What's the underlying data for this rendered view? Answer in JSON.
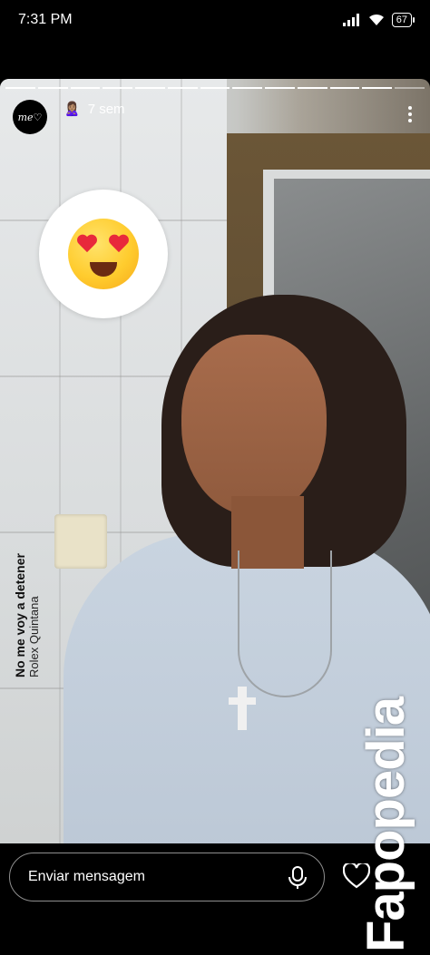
{
  "status_bar": {
    "time": "7:31 PM",
    "battery": "67"
  },
  "story": {
    "progress_segments": 13,
    "progress_done": 12,
    "avatar_text": "me♡",
    "header_emoji": "🙎🏽‍♀️",
    "timestamp": "7 sem",
    "music": {
      "song": "No me voy a detener",
      "artist": "Rolex Quintana"
    }
  },
  "bottom_bar": {
    "message_placeholder": "Enviar mensagem"
  },
  "watermark": "Fapopedia",
  "colors": {
    "background": "#000000",
    "sticker": "#ffffff",
    "heart": "#e8293b"
  }
}
